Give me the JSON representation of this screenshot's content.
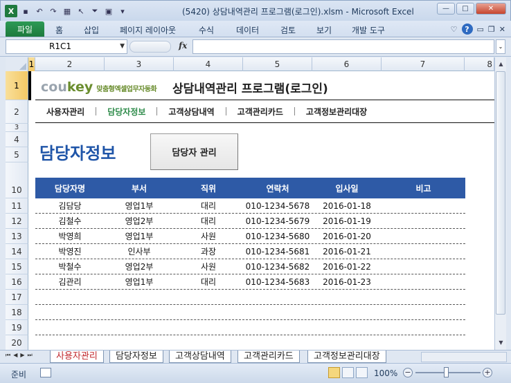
{
  "window": {
    "title": "(5420) 상담내역관리 프로그램(로그인).xlsm  -  Microsoft Excel",
    "minimize": "—",
    "maximize": "□",
    "close": "✕"
  },
  "ribbon": {
    "file_tab": "파일",
    "tabs": [
      "홈",
      "삽입",
      "페이지 레이아웃",
      "수식",
      "데이터",
      "검토",
      "보기",
      "개발 도구"
    ]
  },
  "formula_bar": {
    "name_box": "R1C1",
    "fx": "fx",
    "value": ""
  },
  "grid": {
    "columns": [
      "1",
      "2",
      "3",
      "4",
      "5",
      "6",
      "7",
      "8"
    ],
    "rows": [
      "1",
      "2",
      "3",
      "4",
      "5",
      "10",
      "11",
      "12",
      "13",
      "14",
      "15",
      "16",
      "17",
      "18",
      "19",
      "20"
    ]
  },
  "header": {
    "logo_cou": "cou",
    "logo_key": "key",
    "logo_sub": "맞춤형엑셀업무자동화",
    "app_title": "상담내역관리 프로그램(로그인)"
  },
  "menu": {
    "items": [
      "사용자관리",
      "담당자정보",
      "고객상담내역",
      "고객관리카드",
      "고객정보관리대장"
    ],
    "active_index": 1
  },
  "page": {
    "title": "담당자정보",
    "manage_button": "담당자 관리"
  },
  "table": {
    "headers": [
      "담당자명",
      "부서",
      "직위",
      "연락처",
      "입사일",
      "비고"
    ],
    "rows": [
      [
        "김담당",
        "영업1부",
        "대리",
        "010-1234-5678",
        "2016-01-18",
        ""
      ],
      [
        "김철수",
        "영업2부",
        "대리",
        "010-1234-5679",
        "2016-01-19",
        ""
      ],
      [
        "박영희",
        "영업1부",
        "사원",
        "010-1234-5680",
        "2016-01-20",
        ""
      ],
      [
        "박영진",
        "인사부",
        "과장",
        "010-1234-5681",
        "2016-01-21",
        ""
      ],
      [
        "박철수",
        "영업2부",
        "사원",
        "010-1234-5682",
        "2016-01-22",
        ""
      ],
      [
        "김관리",
        "영업1부",
        "대리",
        "010-1234-5683",
        "2016-01-23",
        ""
      ],
      [
        "",
        "",
        "",
        "",
        "",
        ""
      ],
      [
        "",
        "",
        "",
        "",
        "",
        ""
      ],
      [
        "",
        "",
        "",
        "",
        "",
        ""
      ],
      [
        "",
        "",
        "",
        "",
        "",
        ""
      ]
    ]
  },
  "sheet_tabs": {
    "tabs": [
      "사용자관리",
      "담당자정보",
      "고객상담내역",
      "고객관리카드",
      "고객정보관리대장"
    ],
    "active_index": 1
  },
  "status": {
    "ready": "준비",
    "zoom": "100%"
  },
  "colors": {
    "accent_green": "#2e8b4a",
    "table_header": "#2e5aa6",
    "page_title": "#1f55a8",
    "tab_red": "#c0282d"
  }
}
